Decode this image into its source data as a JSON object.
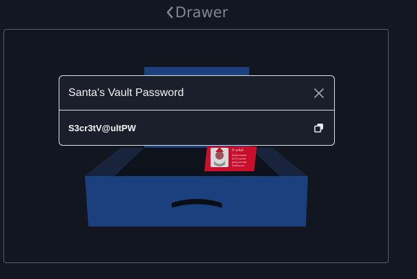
{
  "header": {
    "back_label": "Drawer"
  },
  "dialog": {
    "title": "Santa's Vault Password",
    "secret_value": "S3cr3tV@ultPW"
  },
  "colors": {
    "background": "#131722",
    "drawer_blue": "#1c3f7e",
    "note_red": "#c8102e"
  },
  "icons": {
    "back": "chevron-left-icon",
    "close": "close-icon",
    "copy": "copy-icon"
  }
}
